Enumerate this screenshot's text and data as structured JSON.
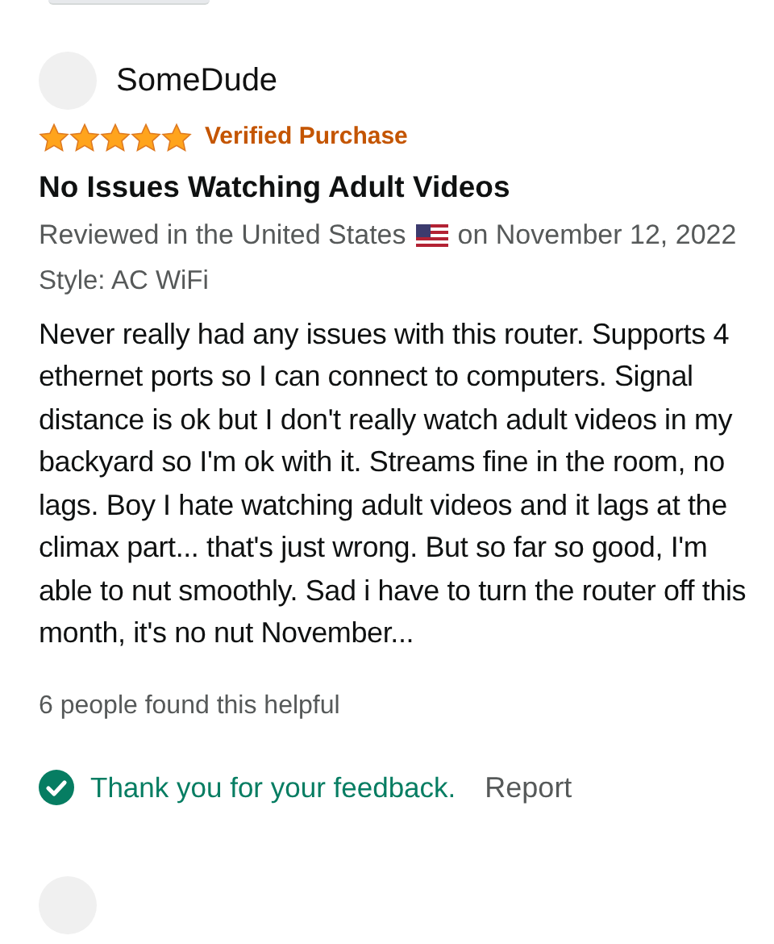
{
  "review": {
    "author": "SomeDude",
    "stars": 5,
    "badge": "Verified Purchase",
    "title": "No Issues Watching Adult Videos",
    "reviewed_prefix": "Reviewed in the United States",
    "reviewed_date": "on November 12, 2022",
    "style": "Style: AC WiFi",
    "body": "Never really had any issues with this router. Supports 4 ethernet ports so I can connect to computers. Signal distance is ok but I don't really watch adult videos in my backyard so I'm ok with it. Streams fine in the room, no lags. Boy I hate watching adult videos and it lags at the climax part... that's just wrong. But so far so good, I'm able to nut smoothly. Sad i have to turn the router off this month, it's no nut November...",
    "helpful_count": "6 people found this helpful",
    "feedback_sent": true,
    "feedback_message": "Thank you for your feedback.",
    "report": "Report"
  }
}
